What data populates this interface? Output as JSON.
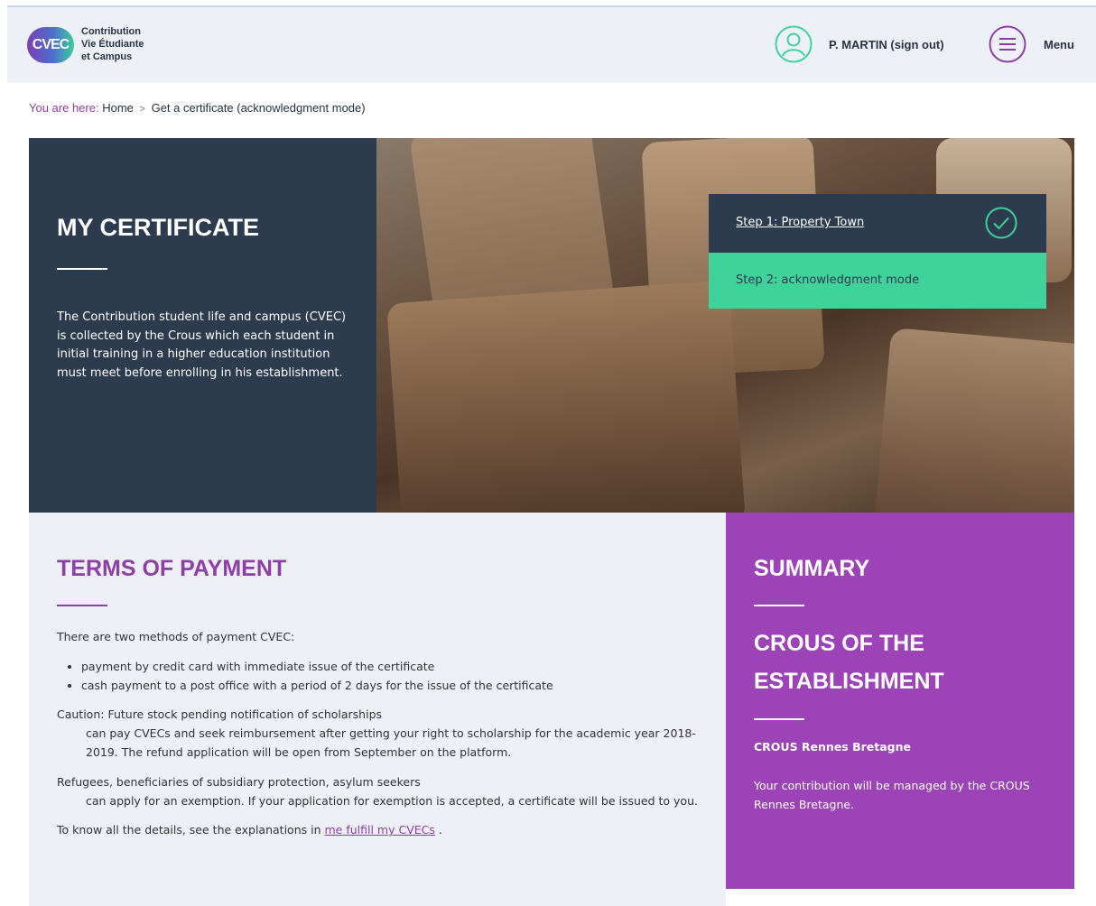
{
  "header": {
    "logo_mark": "CVEC",
    "logo_lines": [
      "Contribution",
      "Vie Étudiante",
      "et Campus"
    ],
    "user_label": "P. MARTIN (sign out)",
    "menu_label": "Menu",
    "user_icon": "user-icon",
    "menu_icon": "hamburger-menu-icon"
  },
  "breadcrumb": {
    "prefix": "You are here:",
    "home": "Home",
    "separator": ">",
    "current": "Get a certificate (acknowledgment mode)"
  },
  "hero": {
    "title": "MY CERTIFICATE",
    "text": "The Contribution student life and campus (CVEC) is collected by the Crous which each student in initial training in a higher education institution must meet before enrolling in his establishment."
  },
  "steps": {
    "step1": {
      "label": "Step 1: Property Town",
      "status_icon": "check-circle-icon"
    },
    "step2": {
      "label": "Step 2: acknowledgment mode"
    }
  },
  "terms": {
    "title": "TERMS OF PAYMENT",
    "intro": "There are two methods of payment CVEC:",
    "methods": [
      "payment by credit card with immediate issue of the certificate",
      "cash payment to a post office with a period of 2 days for the issue of the certificate"
    ],
    "caution_heading": "Caution: Future stock pending notification of scholarships",
    "caution_body": "can pay CVECs and seek reimbursement after getting your right to scholarship for the academic year 2018- 2019. The refund application will be open from September on the platform.",
    "refugees_heading": "Refugees, beneficiaries of subsidiary protection, asylum seekers",
    "refugees_body": "can apply for an exemption. If your application for exemption is accepted, a certificate will be issued to you.",
    "details_prefix": "To know all the details, see the explanations in",
    "details_link": "me fulfill my CVECs",
    "details_suffix": "."
  },
  "summary": {
    "title": "SUMMARY",
    "crous_heading": "CROUS OF THE ESTABLISHMENT",
    "crous_name": "CROUS Rennes Bretagne",
    "description": "Your contribution will be managed by the CROUS Rennes Bretagne."
  },
  "colors": {
    "navy": "#2c3b4d",
    "purple": "#9d43b8",
    "green": "#3fd39b",
    "light_bg": "#eef0f8"
  }
}
